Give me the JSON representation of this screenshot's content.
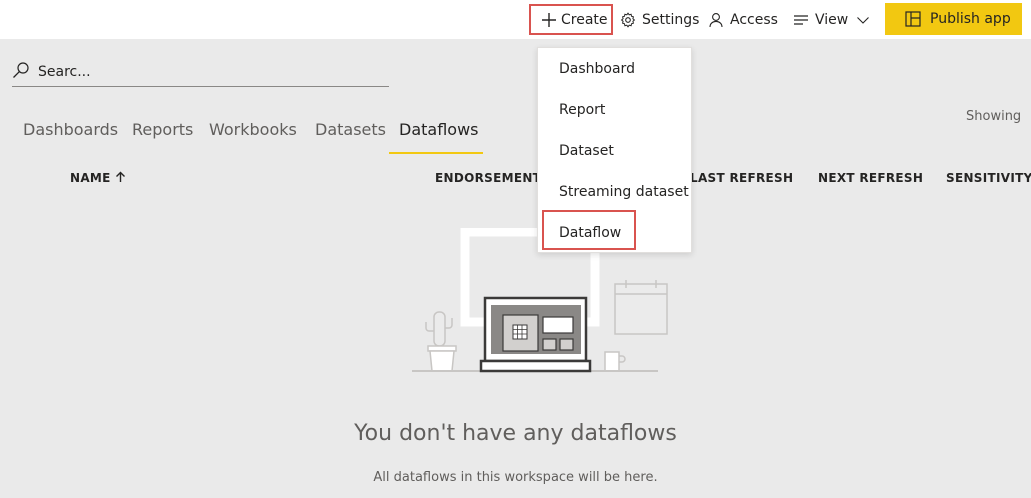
{
  "toolbar": {
    "create_label": "Create",
    "settings_label": "Settings",
    "access_label": "Access",
    "view_label": "View",
    "publish_label": "Publish app"
  },
  "search": {
    "placeholder": "Searc..."
  },
  "showing_label": "Showing",
  "tabs": [
    {
      "label": "Dashboards"
    },
    {
      "label": "Reports"
    },
    {
      "label": "Workbooks"
    },
    {
      "label": "Datasets"
    },
    {
      "label": "Dataflows",
      "active": true
    }
  ],
  "columns": {
    "name": "NAME",
    "endorsement": "ENDORSEMENT...",
    "last_refresh": "LAST REFRESH",
    "next_refresh": "NEXT REFRESH",
    "sensitivity": "SENSITIVITY"
  },
  "create_menu": {
    "items": [
      {
        "label": "Dashboard"
      },
      {
        "label": "Report"
      },
      {
        "label": "Dataset"
      },
      {
        "label": "Streaming dataset"
      },
      {
        "label": "Dataflow",
        "highlighted": true
      }
    ]
  },
  "empty_state": {
    "title": "You don't have any dataflows",
    "subtitle": "All dataflows in this workspace will be here."
  },
  "colors": {
    "accent": "#f2c811",
    "highlight_border": "#d9534f",
    "background": "#eaeaea"
  },
  "icons": {
    "create": "plus-icon",
    "settings": "gear-icon",
    "access": "person-icon",
    "view": "lines-icon",
    "view_dropdown": "chevron-down-icon",
    "publish": "app-grid-icon",
    "search": "search-icon",
    "sort": "arrow-up-icon"
  }
}
